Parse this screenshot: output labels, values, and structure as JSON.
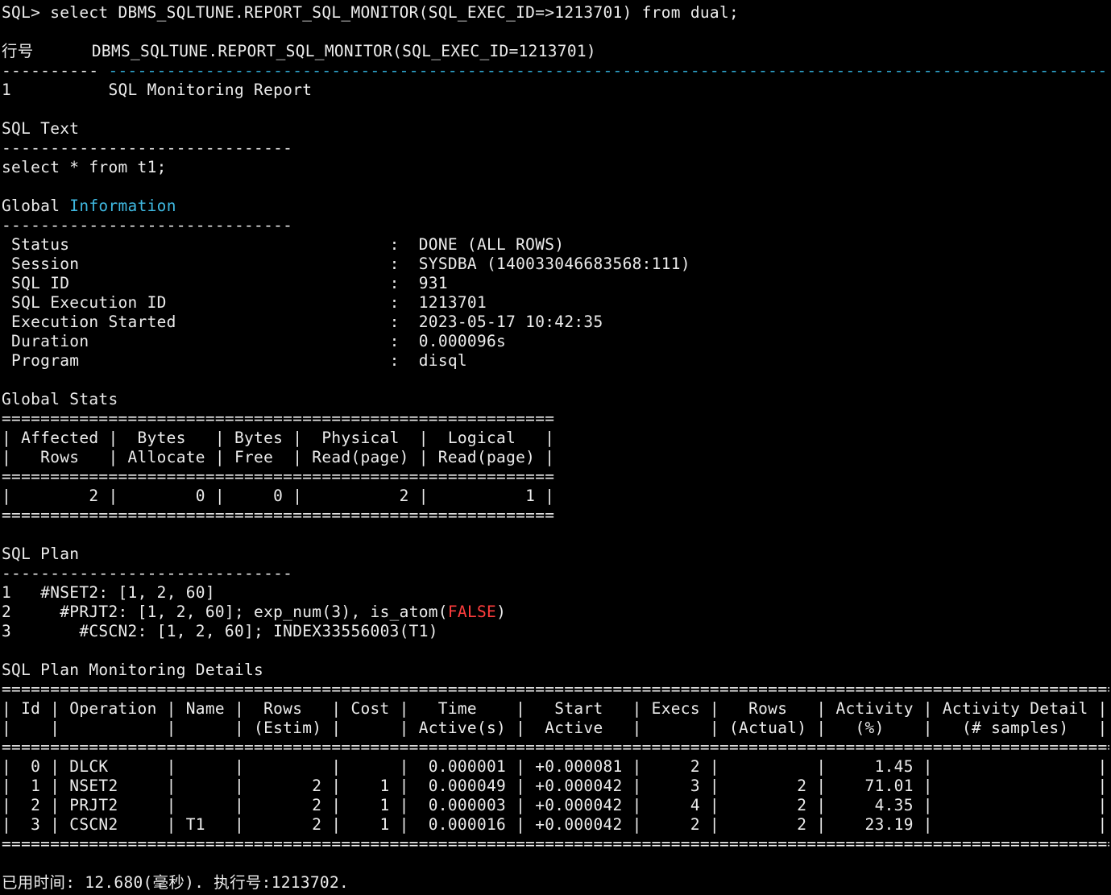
{
  "colors": {
    "background": "#000000",
    "text": "#ececec",
    "keyword_cyan": "#3fb8e0",
    "literal_red": "#ff3d3d"
  },
  "terminal": {
    "command": "SQL> select DBMS_SQLTUNE.REPORT_SQL_MONITOR(SQL_EXEC_ID=>1213701) from dual;",
    "result_header": {
      "row_number_label": "行号",
      "column_name": "DBMS_SQLTUNE.REPORT_SQL_MONITOR(SQL_EXEC_ID=1213701)",
      "row_dash": "----------",
      "column_dash": "-------------------------------------------------------------------------------------------------------"
    },
    "result_row": {
      "row_number": "1",
      "report_title": "SQL Monitoring Report"
    },
    "sql_text": {
      "heading": "SQL Text",
      "rule": "------------------------------",
      "text": "select * from t1;"
    },
    "global_information": {
      "heading_prefix": "Global",
      "heading_keyword": "Information",
      "rule": "------------------------------",
      "rows": [
        {
          "label": " Status",
          "value": "DONE (ALL ROWS)"
        },
        {
          "label": " Session",
          "value": "SYSDBA (140033046683568:111)"
        },
        {
          "label": " SQL ID",
          "value": "931"
        },
        {
          "label": " SQL Execution ID",
          "value": "1213701"
        },
        {
          "label": " Execution Started",
          "value": "2023-05-17 10:42:35"
        },
        {
          "label": " Duration",
          "value": "0.000096s"
        },
        {
          "label": " Program",
          "value": "disql"
        }
      ]
    },
    "global_stats": {
      "heading": "Global Stats",
      "border": "=========================================================",
      "header_lines": [
        "| Affected |  Bytes   | Bytes |  Physical  |  Logical   |",
        "|   Rows   | Allocate | Free  | Read(page) | Read(page) |"
      ],
      "data_lines": [
        "|        2 |        0 |     0 |          2 |          1 |"
      ],
      "values": {
        "affected_rows": 2,
        "bytes_allocate": 0,
        "bytes_free": 0,
        "physical_read_pages": 2,
        "logical_read_pages": 1
      }
    },
    "sql_plan": {
      "heading": "SQL Plan",
      "rule": "------------------------------",
      "steps": [
        {
          "num": "1",
          "text": "#NSET2: [1, 2, 60]"
        },
        {
          "num": "2",
          "text_before": "#PRJT2: [1, 2, 60]; exp_num(3), is_atom(",
          "literal": "FALSE",
          "text_after": ")"
        },
        {
          "num": "3",
          "text": "#CSCN2: [1, 2, 60]; INDEX33556003(T1)"
        }
      ]
    },
    "plan_monitoring": {
      "heading": "SQL Plan Monitoring Details",
      "border": "======================================================================================================================",
      "header_lines": [
        "| Id | Operation | Name |  Rows   | Cost |   Time    |   Start   | Execs |   Rows   | Activity | Activity Detail |",
        "|    |           |      | (Estim) |      | Active(s) |  Active   |       | (Actual) |   (%)    |   (# samples)   |"
      ],
      "row_lines": [
        "|  0 | DLCK      |      |         |      |  0.000001 | +0.000081 |     2 |          |     1.45 |                 |",
        "|  1 | NSET2     |      |       2 |    1 |  0.000049 | +0.000042 |     3 |        2 |    71.01 |                 |",
        "|  2 | PRJT2     |      |       2 |    1 |  0.000003 | +0.000042 |     4 |        2 |     4.35 |                 |",
        "|  3 | CSCN2     | T1   |       2 |    1 |  0.000016 | +0.000042 |     2 |        2 |    23.19 |                 |"
      ],
      "rows": [
        {
          "id": 0,
          "operation": "DLCK",
          "name": "",
          "rows_estim": null,
          "cost": null,
          "time_active_s": "0.000001",
          "start_active": "+0.000081",
          "execs": 2,
          "rows_actual": null,
          "activity_pct": 1.45
        },
        {
          "id": 1,
          "operation": "NSET2",
          "name": "",
          "rows_estim": 2,
          "cost": 1,
          "time_active_s": "0.000049",
          "start_active": "+0.000042",
          "execs": 3,
          "rows_actual": 2,
          "activity_pct": 71.01
        },
        {
          "id": 2,
          "operation": "PRJT2",
          "name": "",
          "rows_estim": 2,
          "cost": 1,
          "time_active_s": "0.000003",
          "start_active": "+0.000042",
          "execs": 4,
          "rows_actual": 2,
          "activity_pct": 4.35
        },
        {
          "id": 3,
          "operation": "CSCN2",
          "name": "T1",
          "rows_estim": 2,
          "cost": 1,
          "time_active_s": "0.000016",
          "start_active": "+0.000042",
          "execs": 2,
          "rows_actual": 2,
          "activity_pct": 23.19
        }
      ]
    },
    "footer": "已用时间: 12.680(毫秒). 执行号:1213702."
  }
}
